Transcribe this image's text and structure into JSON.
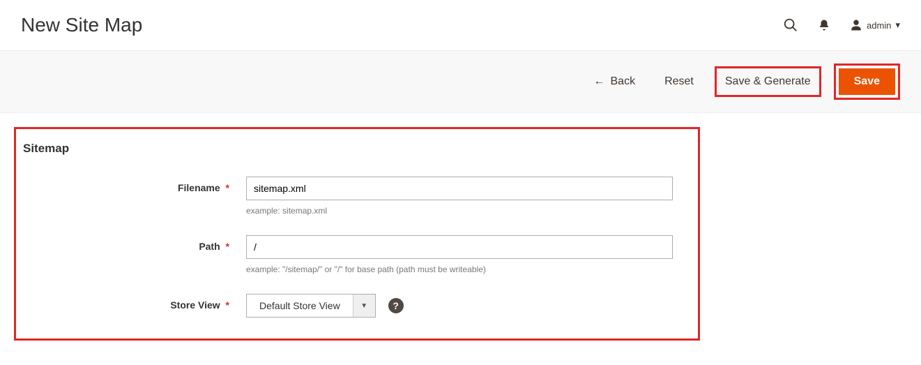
{
  "header": {
    "title": "New Site Map",
    "user_label": "admin"
  },
  "actions": {
    "back_label": "Back",
    "reset_label": "Reset",
    "save_generate_label": "Save & Generate",
    "save_label": "Save"
  },
  "form": {
    "section_title": "Sitemap",
    "filename": {
      "label": "Filename",
      "value": "sitemap.xml",
      "help": "example: sitemap.xml"
    },
    "path": {
      "label": "Path",
      "value": "/",
      "help": "example: \"/sitemap/\" or \"/\" for base path (path must be writeable)"
    },
    "store_view": {
      "label": "Store View",
      "value": "Default Store View"
    }
  },
  "icons": {
    "help_glyph": "?"
  }
}
